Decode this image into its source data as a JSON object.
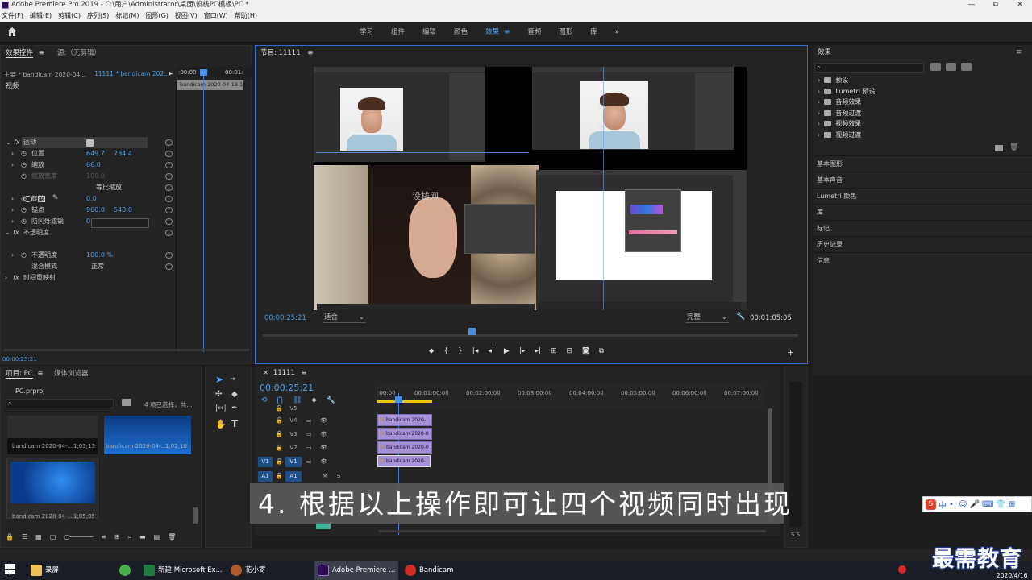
{
  "app": {
    "title": "Adobe Premiere Pro 2019 - C:\\用户\\Administrator\\桌面\\设栈PC模板\\PC *",
    "win_min": "—",
    "win_max": "⧉",
    "win_close": "✕"
  },
  "menu": [
    "文件(F)",
    "编辑(E)",
    "剪辑(C)",
    "序列(S)",
    "标记(M)",
    "图形(G)",
    "视图(V)",
    "窗口(W)",
    "帮助(H)"
  ],
  "workspaces": [
    {
      "label": "学习"
    },
    {
      "label": "组件"
    },
    {
      "label": "编辑"
    },
    {
      "label": "颜色"
    },
    {
      "label": "效果",
      "active": true
    },
    {
      "label": "音频"
    },
    {
      "label": "图形"
    },
    {
      "label": "库"
    }
  ],
  "workspace_more": "»",
  "effect_controls": {
    "tab": "效果控件",
    "tab_menu": "≡",
    "source_tab": "源:（无剪辑）",
    "master": "主要 * bandicam 2020-04...",
    "clip": "11111 * bandicam 202...",
    "ruler_start": ":00:00",
    "ruler_end": "00:01:",
    "clip_bar": "bandicam 2020-04-13 1",
    "section_video": "视频",
    "rows": [
      {
        "label": "运动",
        "fx": true
      },
      {
        "label": "位置",
        "v1": "649.7",
        "v2": "734.4"
      },
      {
        "label": "缩放",
        "v1": "66.0"
      },
      {
        "label": "缩放宽度",
        "v1": "100.0",
        "dim": true
      },
      {
        "label": "等比缩放"
      },
      {
        "label": "旋转",
        "v1": "0.0"
      },
      {
        "label": "锚点",
        "v1": "960.0",
        "v2": "540.0"
      },
      {
        "label": "防闪烁滤镜",
        "v1": "0.00"
      },
      {
        "label": "不透明度",
        "fx": true
      },
      {
        "label": "不透明度",
        "v1": "100.0 %"
      },
      {
        "label": "混合模式",
        "v1": "正常"
      },
      {
        "label": "时间重映射",
        "fx": true
      }
    ],
    "timecode": "00:00:25:21"
  },
  "program": {
    "title": "节目: 11111",
    "menu": "≡",
    "timecode": "00:00:25:21",
    "fit": "适合",
    "quality": "完整",
    "duration": "00:01:05:05",
    "watermark": "设栈网"
  },
  "project": {
    "tab": "项目: PC",
    "menu": "≡",
    "media_tab": "媒体浏览器",
    "file": "PC.prproj",
    "selection": "4 项已选择，共...",
    "items": [
      {
        "name": "bandicam 2020-04-...",
        "dur": "1;03;13"
      },
      {
        "name": "bandicam 2020-04-...",
        "dur": "1;02;10"
      },
      {
        "name": "bandicam 2020-04-...",
        "dur": "1;05;05"
      }
    ]
  },
  "timeline": {
    "tab": "11111",
    "menu": "≡",
    "timecode": "00:00:25:21",
    "ruler": [
      ":00:00",
      "00:01:00:00",
      "00:02:00:00",
      "00:03:00:00",
      "00:04:00:00",
      "00:05:00:00",
      "00:06:00:00",
      "00:07:00:00"
    ],
    "tracks": [
      {
        "name": "V5"
      },
      {
        "name": "V4"
      },
      {
        "name": "V3"
      },
      {
        "name": "V2"
      },
      {
        "name": "V1",
        "src": "V1"
      },
      {
        "name": "A1",
        "src": "A1"
      }
    ],
    "clips": [
      "bandicam 2020-",
      "bandicam 2020-0",
      "bandicam 2020-0",
      "bandicam 2020-"
    ],
    "audio_labels": [
      "M",
      "S"
    ]
  },
  "effects_panel": {
    "title": "效果",
    "menu": "≡",
    "tree": [
      "预设",
      "Lumetri 预设",
      "音频效果",
      "音频过渡",
      "视频效果",
      "视频过渡"
    ],
    "sections": [
      "基本图形",
      "基本声音",
      "Lumetri 颜色",
      "库",
      "标记",
      "历史记录",
      "信息"
    ]
  },
  "caption": "4. 根据以上操作即可让四个视频同时出现",
  "ime": "中",
  "watermark": "最需教育",
  "taskbar": {
    "items": [
      "录屏",
      "新建 Microsoft Ex...",
      "花小寄",
      "Adobe Premiere ...",
      "Bandicam"
    ],
    "date": "2020/4/16"
  },
  "colors": {
    "accent": "#4f9ee6",
    "clip": "#a592d6",
    "monitor_border": "#2d6ed0"
  }
}
